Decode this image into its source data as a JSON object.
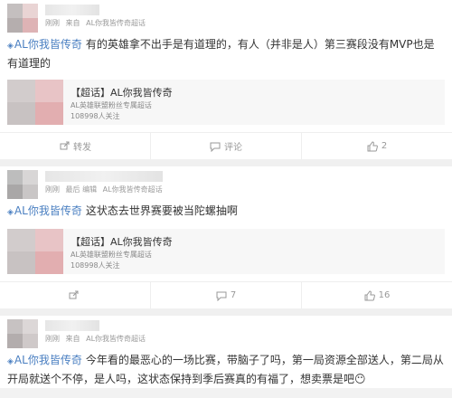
{
  "posts": [
    {
      "meta": {
        "time": "刚刚",
        "from_prefix": "来自",
        "from_source": "AL你我皆传奇超话"
      },
      "topic": "AL你我皆传奇",
      "text": "有的英雄拿不出手是有道理的，有人（并非是人）第三赛段没有MVP也是有道理的",
      "share": {
        "title": "【超话】AL你我皆传奇",
        "subtitle": "AL英雄联盟粉丝专属超话",
        "followers": "108998人关注"
      },
      "actions": {
        "repost": "转发",
        "comment": "评论",
        "like": "2"
      }
    },
    {
      "meta": {
        "time": "刚刚",
        "from_prefix": "最后 编辑",
        "from_source": "AL你我皆传奇超话"
      },
      "topic": "AL你我皆传奇",
      "text": "这状态去世界赛要被当陀螺抽啊",
      "share": {
        "title": "【超话】AL你我皆传奇",
        "subtitle": "AL英雄联盟粉丝专属超话",
        "followers": "108998人关注"
      },
      "actions": {
        "repost": "",
        "comment": "7",
        "like": "16"
      }
    },
    {
      "meta": {
        "time": "刚刚",
        "from_prefix": "来自",
        "from_source": "AL你我皆传奇超话"
      },
      "topic": "AL你我皆传奇",
      "text": "今年看的最恶心的一场比赛，带脑子了吗，第一局资源全部送人，第二局从开局就送个不停，是人吗，这状态保持到季后赛真的有福了，想卖票是吧😶"
    }
  ],
  "colors": {
    "link": "#4a7fc1",
    "muted": "#999999",
    "avatar_blur": [
      "#c9c4c4",
      "#e8cbcb",
      "#bdb7b7",
      "#e2aeb0"
    ]
  },
  "icons": {
    "topic": "super-topic-icon",
    "repost": "repost-icon",
    "comment": "comment-icon",
    "like": "thumbs-up-icon"
  }
}
